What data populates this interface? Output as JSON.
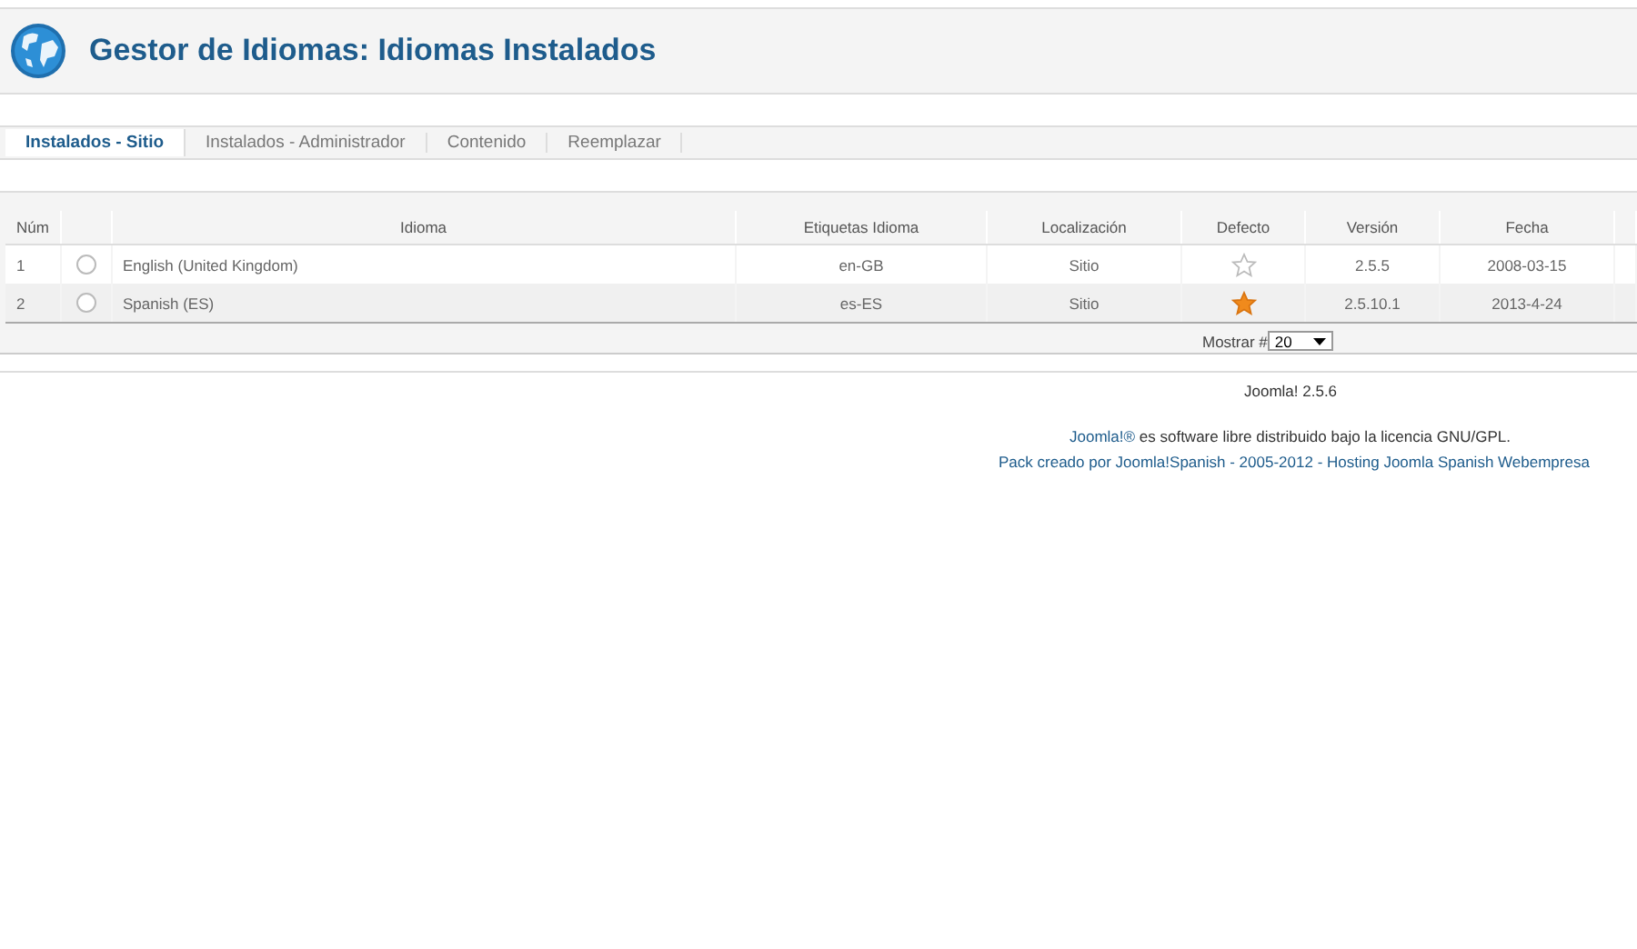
{
  "header": {
    "title": "Gestor de Idiomas: Idiomas Instalados"
  },
  "tabs": [
    {
      "label": "Instalados - Sitio",
      "selected": true
    },
    {
      "label": "Instalados - Administrador",
      "selected": false
    },
    {
      "label": "Contenido",
      "selected": false
    },
    {
      "label": "Reemplazar",
      "selected": false
    }
  ],
  "table": {
    "columns": [
      "Núm",
      "Idioma",
      "Etiquetas Idioma",
      "Localización",
      "Defecto",
      "Versión",
      "Fecha"
    ],
    "rows": [
      {
        "num": "1",
        "selected": false,
        "language": "English (United Kingdom)",
        "tag": "en-GB",
        "location": "Sitio",
        "default": false,
        "version": "2.5.5",
        "date": "2008-03-15"
      },
      {
        "num": "2",
        "selected": false,
        "language": "Spanish (ES)",
        "tag": "es-ES",
        "location": "Sitio",
        "default": true,
        "version": "2.5.10.1",
        "date": "2013-4-24"
      }
    ]
  },
  "pagination": {
    "label": "Mostrar #",
    "value": "20"
  },
  "footer": {
    "version": "Joomla! 2.5.6",
    "license_link": "Joomla!®",
    "license_text": " es software libre distribuido bajo la licencia GNU/GPL.",
    "credits_link": "Pack creado por Joomla!Spanish - 2005-2012",
    "separator": " - ",
    "hosting_link": "Hosting Joomla Spanish Webempresa"
  }
}
